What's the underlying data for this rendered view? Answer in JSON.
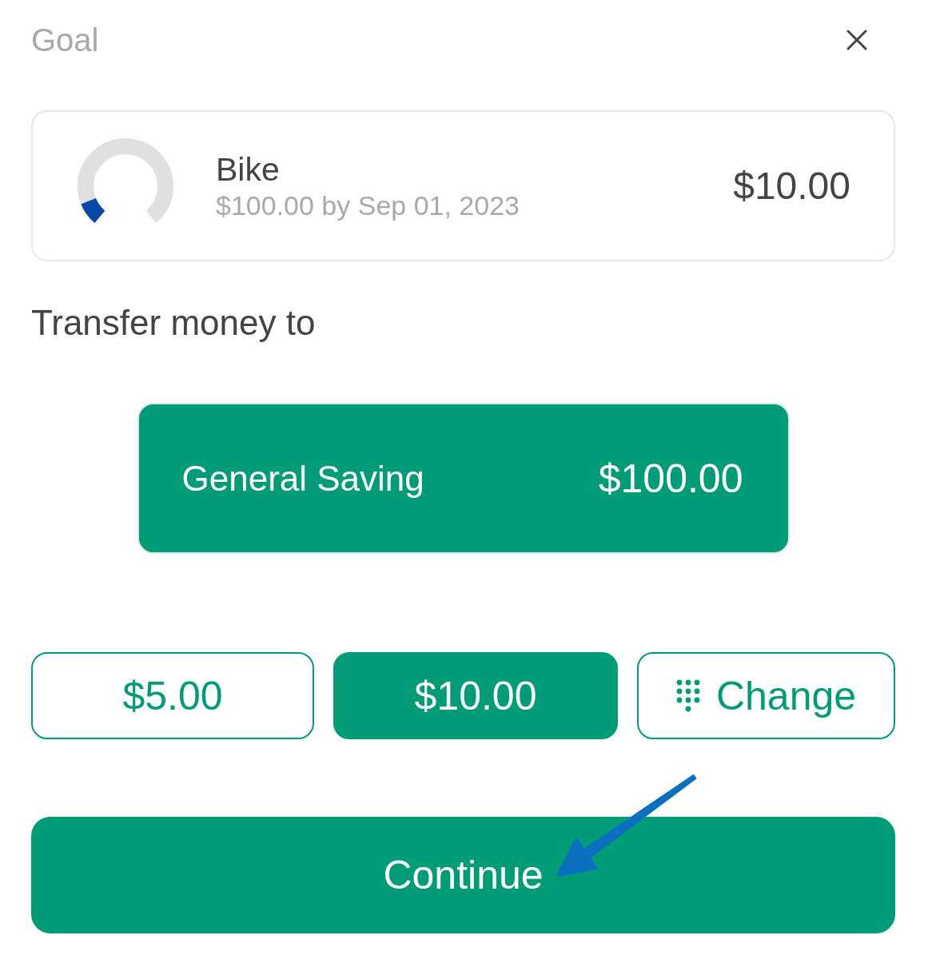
{
  "header": {
    "title": "Goal"
  },
  "goal": {
    "name": "Bike",
    "detail": "$100.00 by Sep 01, 2023",
    "saved": "$10.00",
    "level": 0.1
  },
  "transfer": {
    "label": "Transfer money to",
    "accounts": [
      {
        "name": "General Saving",
        "balance": "$100.00",
        "selected": true
      }
    ]
  },
  "amounts": [
    {
      "kind": "amount",
      "label": "$5.00",
      "selected": false
    },
    {
      "kind": "amount",
      "label": "$10.00",
      "selected": true
    },
    {
      "kind": "custom",
      "label": "Change",
      "selected": false
    }
  ],
  "continue_button": {
    "label": "Continue"
  }
}
